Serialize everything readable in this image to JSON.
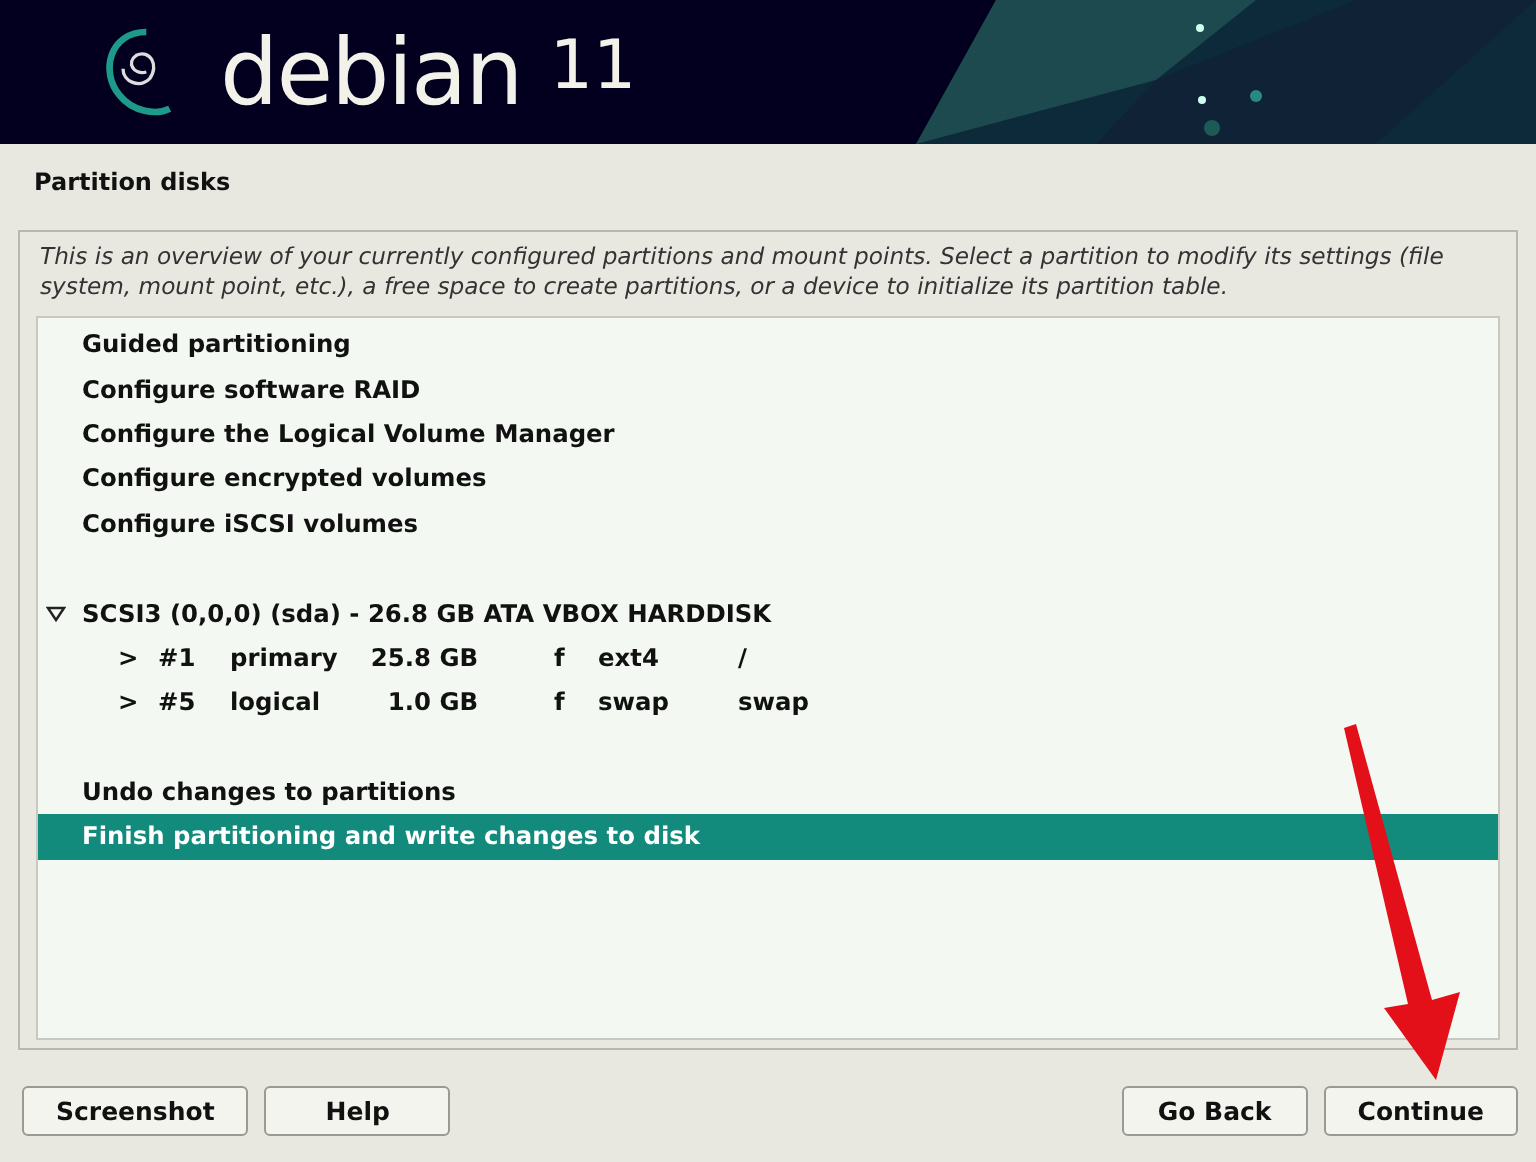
{
  "header": {
    "brand": "debian",
    "version": "11"
  },
  "title": "Partition disks",
  "description": "This is an overview of your currently configured partitions and mount points. Select a partition to modify its settings (file system, mount point, etc.), a free space to create partitions, or a device to initialize its partition table.",
  "menu": {
    "top_items": [
      {
        "label": "Guided partitioning",
        "selected": false
      },
      {
        "label": "Configure software RAID",
        "selected": false
      },
      {
        "label": "Configure the Logical Volume Manager",
        "selected": false
      },
      {
        "label": "Configure encrypted volumes",
        "selected": false
      },
      {
        "label": "Configure iSCSI volumes",
        "selected": false
      }
    ],
    "disk": {
      "label": "SCSI3 (0,0,0) (sda) - 26.8 GB ATA VBOX HARDDISK",
      "expanded": true,
      "selected": false,
      "partitions": [
        {
          "marker": ">",
          "number": "#1",
          "type": "primary",
          "size": "25.8 GB",
          "flag": "f",
          "filesystem": "ext4",
          "mount": "/",
          "selected": false
        },
        {
          "marker": ">",
          "number": "#5",
          "type": "logical",
          "size": "1.0 GB",
          "flag": "f",
          "filesystem": "swap",
          "mount": "swap",
          "selected": false
        }
      ]
    },
    "bottom_items": [
      {
        "label": "Undo changes to partitions",
        "selected": false
      },
      {
        "label": "Finish partitioning and write changes to disk",
        "selected": true
      }
    ]
  },
  "buttons_left": [
    "Screenshot",
    "Help"
  ],
  "buttons_right": [
    "Go Back",
    "Continue"
  ]
}
